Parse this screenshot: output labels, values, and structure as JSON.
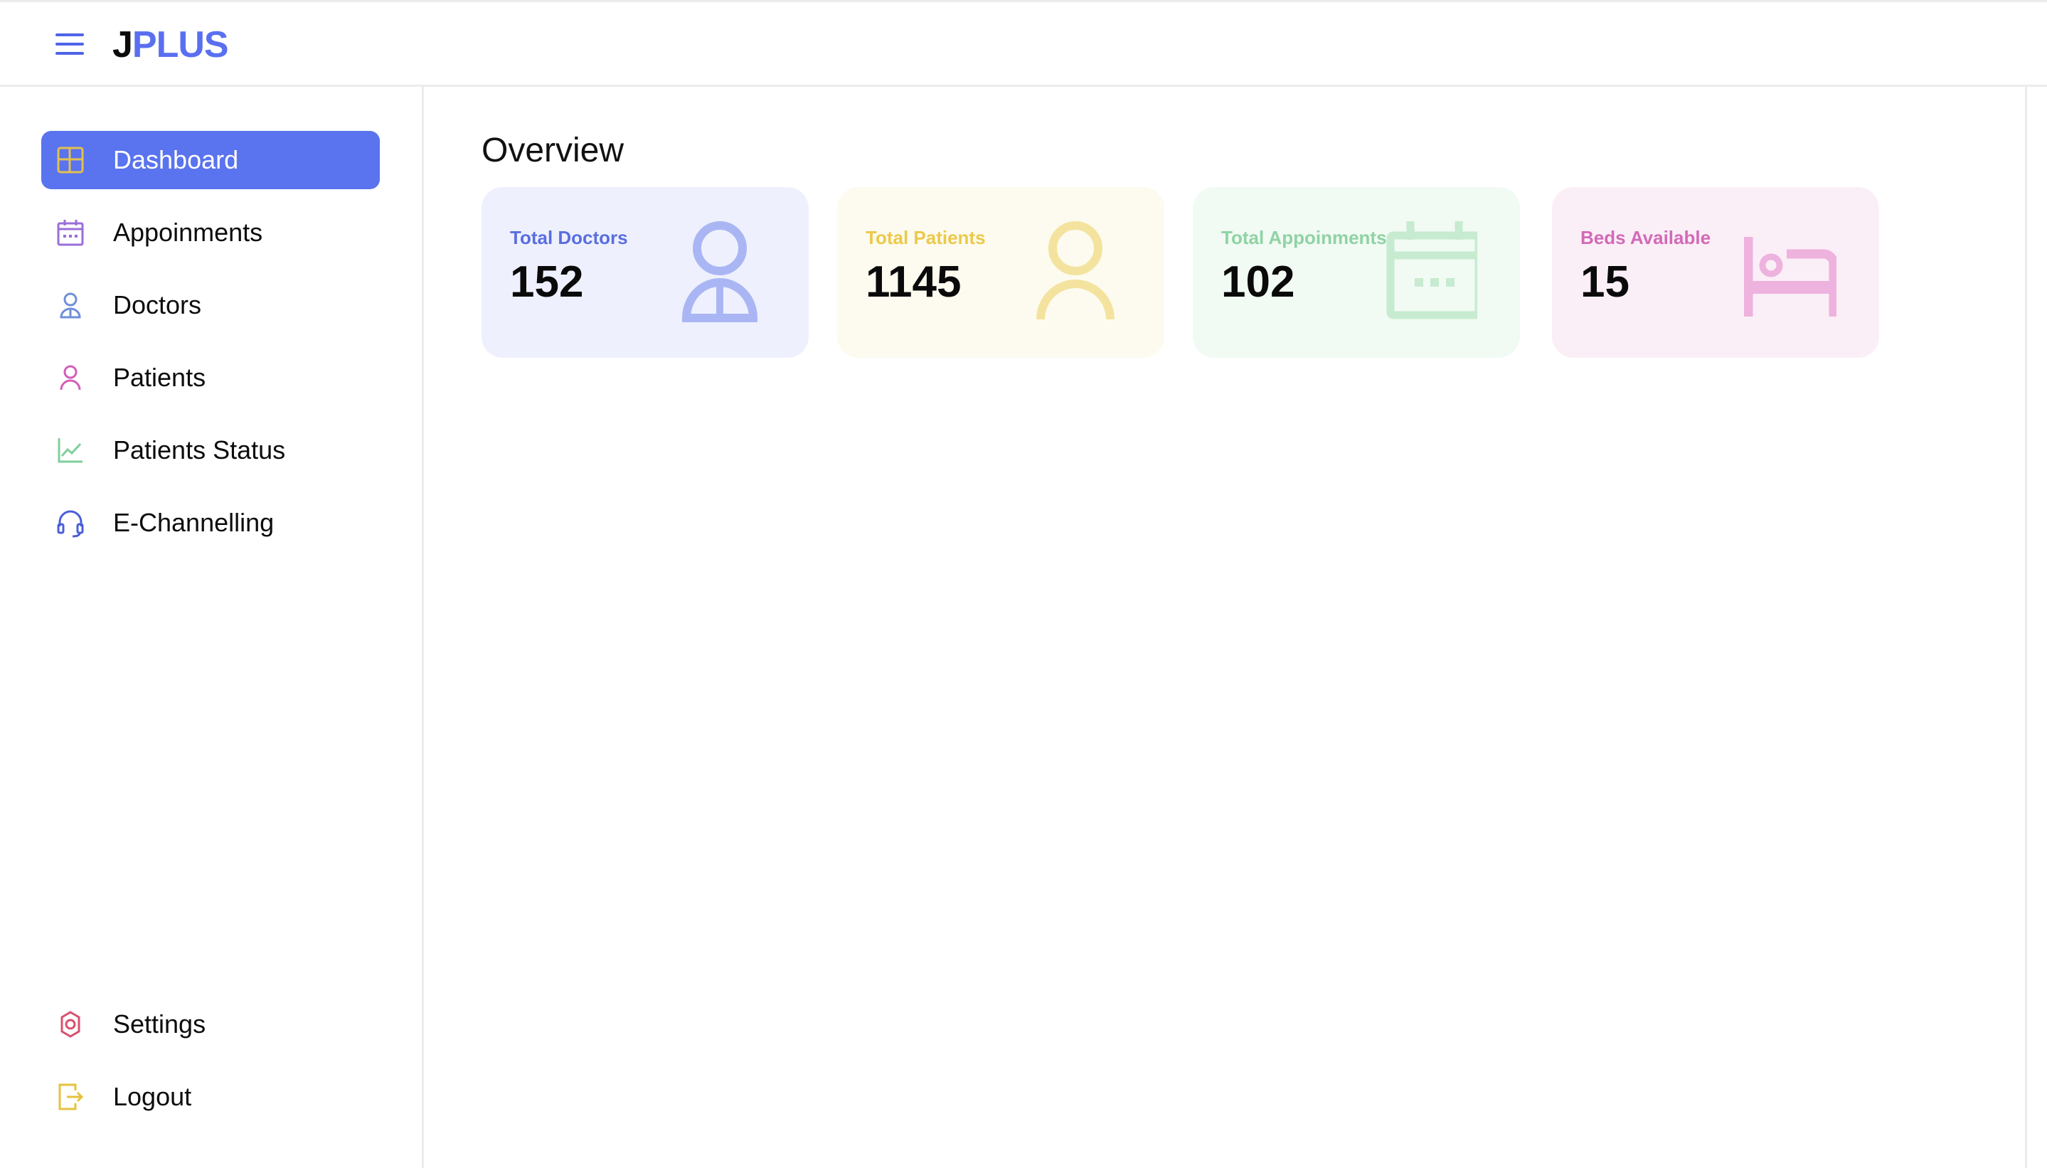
{
  "app": {
    "logo_first": "J",
    "logo_rest": "PLUS"
  },
  "sidebar": {
    "items": [
      {
        "label": "Dashboard",
        "icon": "dashboard-icon",
        "active": true
      },
      {
        "label": "Appoinments",
        "icon": "calendar-icon"
      },
      {
        "label": "Doctors",
        "icon": "doctor-icon"
      },
      {
        "label": "Patients",
        "icon": "person-icon"
      },
      {
        "label": "Patients Status",
        "icon": "chart-line-icon"
      },
      {
        "label": "E-Channelling",
        "icon": "headset-icon"
      }
    ],
    "bottom_items": [
      {
        "label": "Settings",
        "icon": "gear-icon"
      },
      {
        "label": "Logout",
        "icon": "logout-icon"
      }
    ]
  },
  "main": {
    "title": "Overview",
    "cards": [
      {
        "label": "Total Doctors",
        "value": "152",
        "icon": "doctor-icon",
        "color": "#5a6ee0",
        "bg": "#eef1fd"
      },
      {
        "label": "Total Patients",
        "value": "1145",
        "icon": "person-icon",
        "color": "#ecc94a",
        "bg": "#fdfbef"
      },
      {
        "label": "Total Appoinments",
        "value": "102",
        "icon": "calendar-icon",
        "color": "#8fd3a4",
        "bg": "#f1faf3"
      },
      {
        "label": "Beds Available",
        "value": "15",
        "icon": "bed-icon",
        "color": "#d26ab8",
        "bg": "#fbeff7"
      }
    ]
  },
  "colors": {
    "accent": "#5a73ee",
    "border": "#ececec"
  }
}
